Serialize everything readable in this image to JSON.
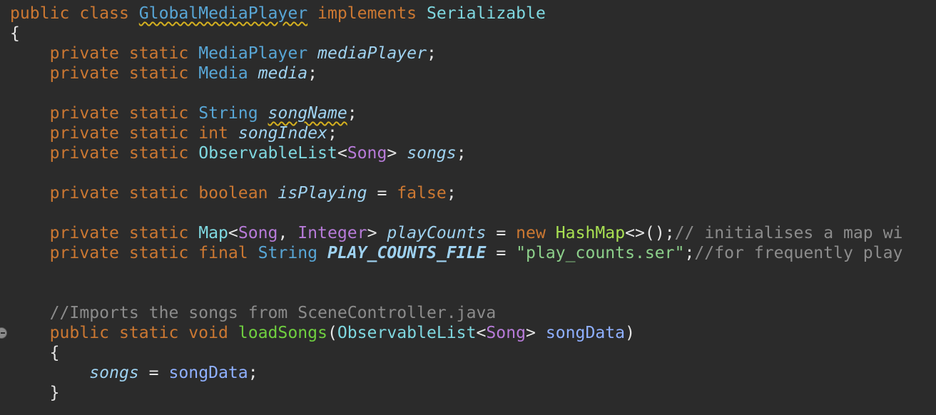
{
  "code": {
    "l1": {
      "public": "public",
      "class": "class",
      "name": "GlobalMediaPlayer",
      "implements": "implements",
      "iface": "Serializable"
    },
    "l2": {
      "brace": "{"
    },
    "l3": {
      "mods": "private static",
      "type": "MediaPlayer",
      "field": "mediaPlayer",
      "end": ";"
    },
    "l4": {
      "mods": "private static",
      "type": "Media",
      "field": "media",
      "end": ";"
    },
    "l6": {
      "mods": "private static",
      "type": "String",
      "field": "songName",
      "end": ";"
    },
    "l7": {
      "mods": "private static",
      "type": "int",
      "field": "songIndex",
      "end": ";"
    },
    "l8": {
      "mods": "private static",
      "type": "ObservableList",
      "lt": "<",
      "generic": "Song",
      "gt": ">",
      "field": "songs",
      "end": ";"
    },
    "l10": {
      "mods": "private static",
      "type": "boolean",
      "field": "isPlaying",
      "eq": "=",
      "value": "false",
      "end": ";"
    },
    "l12": {
      "mods": "private static",
      "type": "Map",
      "lt": "<",
      "generic1": "Song",
      "comma": ",",
      "generic2": "Integer",
      "gt": ">",
      "field": "playCounts",
      "eq": "=",
      "new": "new",
      "ctor": "HashMap",
      "rest": "<>();",
      "comment": "// initialises a map wi"
    },
    "l13": {
      "mods": "private static final",
      "type": "String",
      "field": "PLAY_COUNTS_FILE",
      "eq": "=",
      "str": "\"play_counts.ser\"",
      "end": ";",
      "comment": "//for frequently play"
    },
    "l16": {
      "comment": "//Imports the songs from SceneController.java"
    },
    "l17": {
      "mods": "public static void",
      "method": "loadSongs",
      "open": "(",
      "type": "ObservableList",
      "lt": "<",
      "generic": "Song",
      "gt": ">",
      "param": "songData",
      "close": ")"
    },
    "l18": {
      "brace": "{"
    },
    "l19": {
      "field": "songs",
      "eq": "=",
      "param": "songData",
      "end": ";"
    },
    "l20": {
      "brace": "}"
    }
  },
  "gutter": {
    "marker_icon": "override-method-icon"
  }
}
